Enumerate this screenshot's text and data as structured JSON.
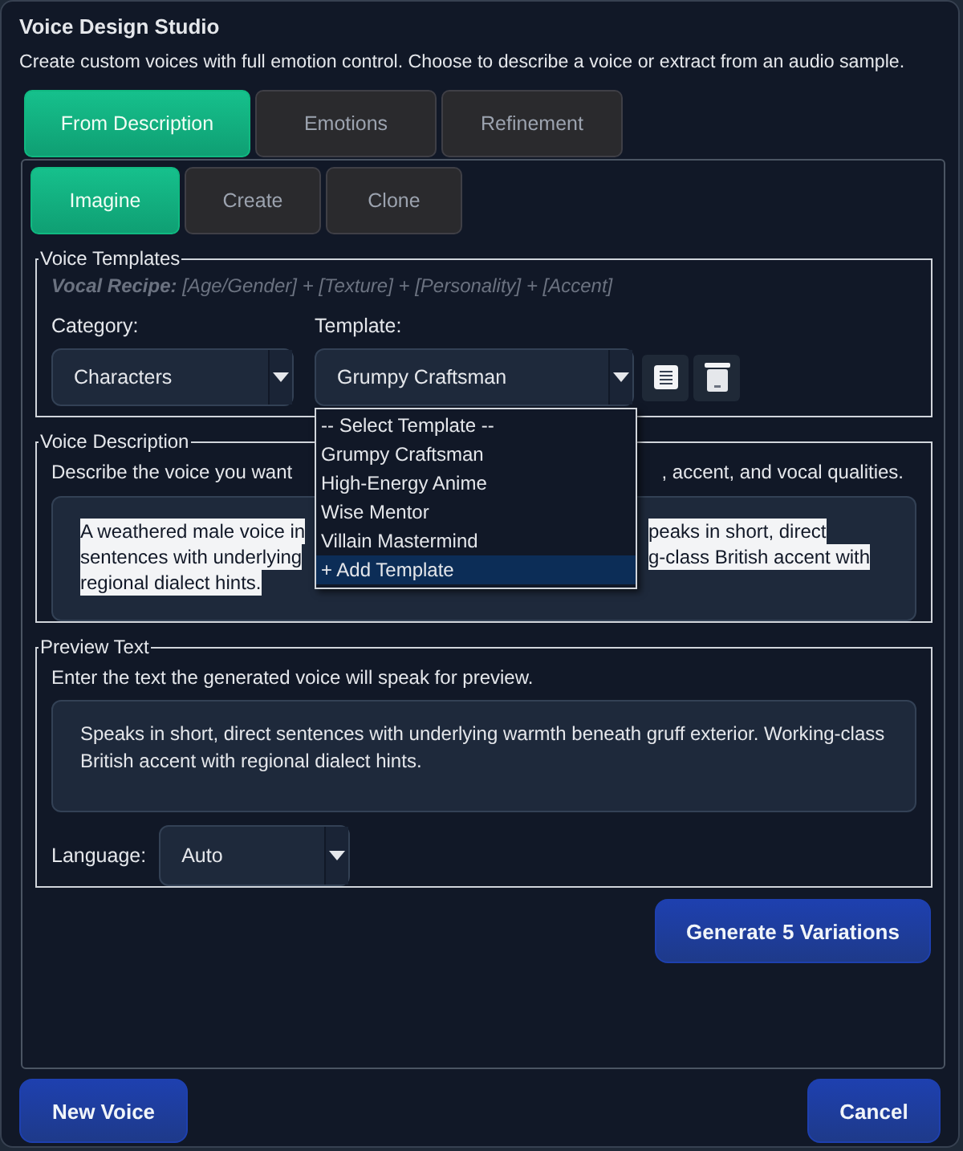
{
  "window": {
    "title": "Voice Design Studio",
    "subtitle": "Create custom voices with full emotion control. Choose to describe a voice or extract from an audio sample."
  },
  "tabs": [
    {
      "label": "From Description",
      "selected": true
    },
    {
      "label": "Emotions",
      "selected": false
    },
    {
      "label": "Refinement",
      "selected": false
    }
  ],
  "subtabs": [
    {
      "label": "Imagine",
      "selected": true
    },
    {
      "label": "Create",
      "selected": false
    },
    {
      "label": "Clone",
      "selected": false
    }
  ],
  "templates_group": {
    "title": "Voice Templates",
    "recipe": "**Vocal Recipe:** [Age/Gender] + [Texture] + [Personality] + [Accent]",
    "category_label": "Category:",
    "category_value": "Characters",
    "template_label": "Template:",
    "template_value": "Grumpy Craftsman",
    "template_dropdown_expanded": true,
    "template_options": [
      {
        "label": "-- Select Template --",
        "selected": false
      },
      {
        "label": "Grumpy Craftsman",
        "selected": false
      },
      {
        "label": "High-Energy Anime",
        "selected": false
      },
      {
        "label": "Wise Mentor",
        "selected": false
      },
      {
        "label": "Villain Mastermind",
        "selected": false
      },
      {
        "label": "+ Add Template",
        "selected": true
      }
    ]
  },
  "description_group": {
    "title": "Voice Description",
    "hint_left": "Describe the voice you want",
    "hint_right": ", accent, and vocal qualities.",
    "text_selected": true,
    "text_lines": [
      {
        "left": "A weathered male voice in",
        "right": "peaks in short, direct"
      },
      {
        "left": "sentences with underlying",
        "right": "g-class British accent with"
      },
      {
        "left": "regional dialect hints."
      }
    ]
  },
  "preview_group": {
    "title": "Preview Text",
    "hint": "Enter the text the generated voice will speak for preview.",
    "text": "Speaks in short, direct sentences with underlying warmth beneath gruff exterior. Working-class British accent with regional dialect hints.",
    "language_label": "Language:",
    "language_value": "Auto"
  },
  "generate_button": "Generate 5 Variations",
  "footer_buttons": [
    "New Voice",
    "Cancel"
  ]
}
